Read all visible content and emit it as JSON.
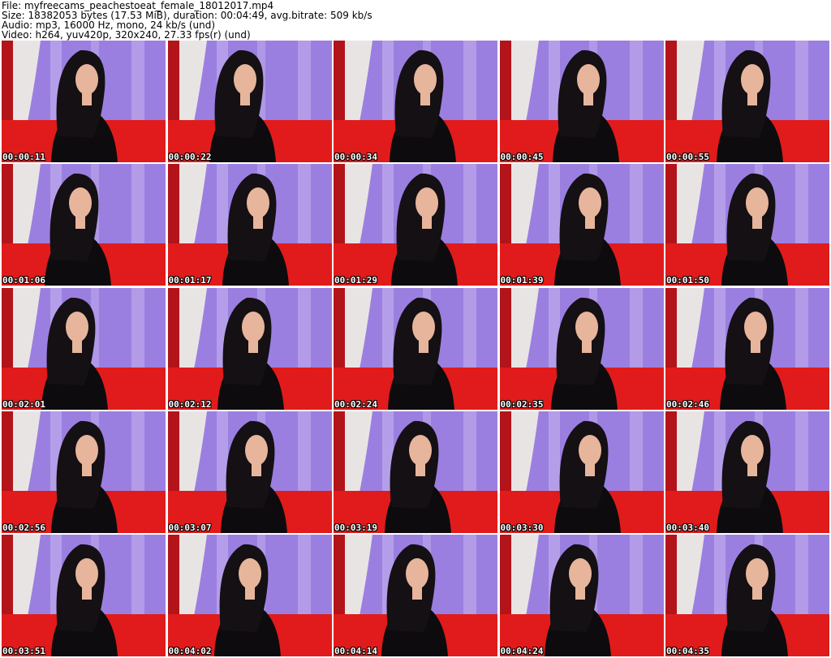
{
  "header": {
    "file_line": "File: myfreecams_peachestoeat_female_18012017.mp4",
    "size_line": "Size: 18382053 bytes (17.53 MiB), duration: 00:04:49, avg.bitrate: 509 kb/s",
    "audio_line": "Audio: mp3, 16000 Hz, mono, 24 kb/s (und)",
    "video_line": "Video: h264, yuv420p, 320x240, 27.33 fps(r) (und)"
  },
  "colors": {
    "curtain": "#9b7fe0",
    "curtain_light": "#c6b2ef",
    "sofa": "#e11b1b",
    "hair": "#141014",
    "skin": "#e7b59b",
    "top": "#0d0b0d",
    "drape": "#e9e4e4"
  },
  "thumbnails": [
    {
      "timestamp": "00:00:11"
    },
    {
      "timestamp": "00:00:22"
    },
    {
      "timestamp": "00:00:34"
    },
    {
      "timestamp": "00:00:45"
    },
    {
      "timestamp": "00:00:55"
    },
    {
      "timestamp": "00:01:06"
    },
    {
      "timestamp": "00:01:17"
    },
    {
      "timestamp": "00:01:29"
    },
    {
      "timestamp": "00:01:39"
    },
    {
      "timestamp": "00:01:50"
    },
    {
      "timestamp": "00:02:01"
    },
    {
      "timestamp": "00:02:12"
    },
    {
      "timestamp": "00:02:24"
    },
    {
      "timestamp": "00:02:35"
    },
    {
      "timestamp": "00:02:46"
    },
    {
      "timestamp": "00:02:56"
    },
    {
      "timestamp": "00:03:07"
    },
    {
      "timestamp": "00:03:19"
    },
    {
      "timestamp": "00:03:30"
    },
    {
      "timestamp": "00:03:40"
    },
    {
      "timestamp": "00:03:51"
    },
    {
      "timestamp": "00:04:02"
    },
    {
      "timestamp": "00:04:14"
    },
    {
      "timestamp": "00:04:24"
    },
    {
      "timestamp": "00:04:35"
    }
  ]
}
